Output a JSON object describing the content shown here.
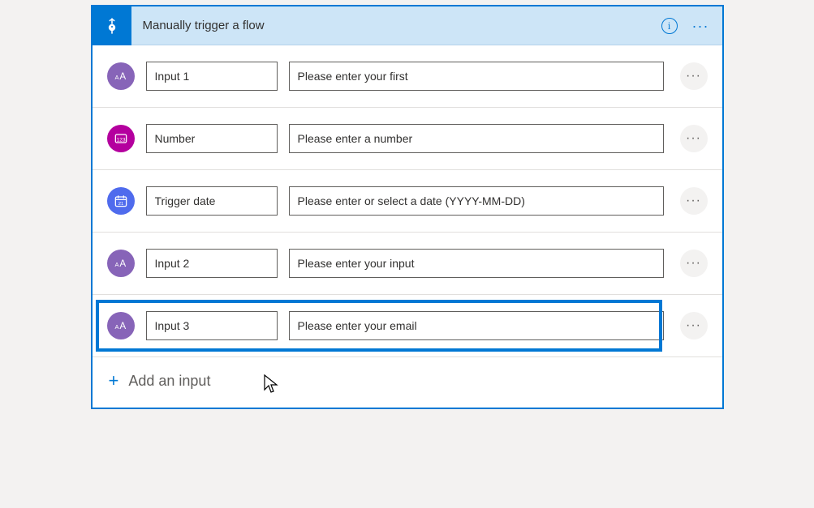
{
  "header": {
    "title": "Manually trigger a flow",
    "info_glyph": "i",
    "ellipsis_glyph": "···"
  },
  "rows": [
    {
      "icon_type": "text",
      "name": "Input 1",
      "placeholder": "Please enter your first",
      "highlighted": false
    },
    {
      "icon_type": "number",
      "name": "Number",
      "placeholder": "Please enter a number",
      "highlighted": false
    },
    {
      "icon_type": "date",
      "name": "Trigger date",
      "placeholder": "Please enter or select a date (YYYY-MM-DD)",
      "highlighted": false
    },
    {
      "icon_type": "text",
      "name": "Input 2",
      "placeholder": "Please enter your input",
      "highlighted": false
    },
    {
      "icon_type": "text",
      "name": "Input 3",
      "placeholder": "Please enter your email",
      "highlighted": true
    }
  ],
  "add": {
    "plus": "+",
    "label": "Add an input"
  },
  "row_menu_glyph": "···",
  "colors": {
    "accent": "#0078d4",
    "header_bg": "#cde5f7",
    "text_icon": "#8764b8",
    "number_icon": "#b4009e",
    "date_icon": "#4f6bed"
  }
}
